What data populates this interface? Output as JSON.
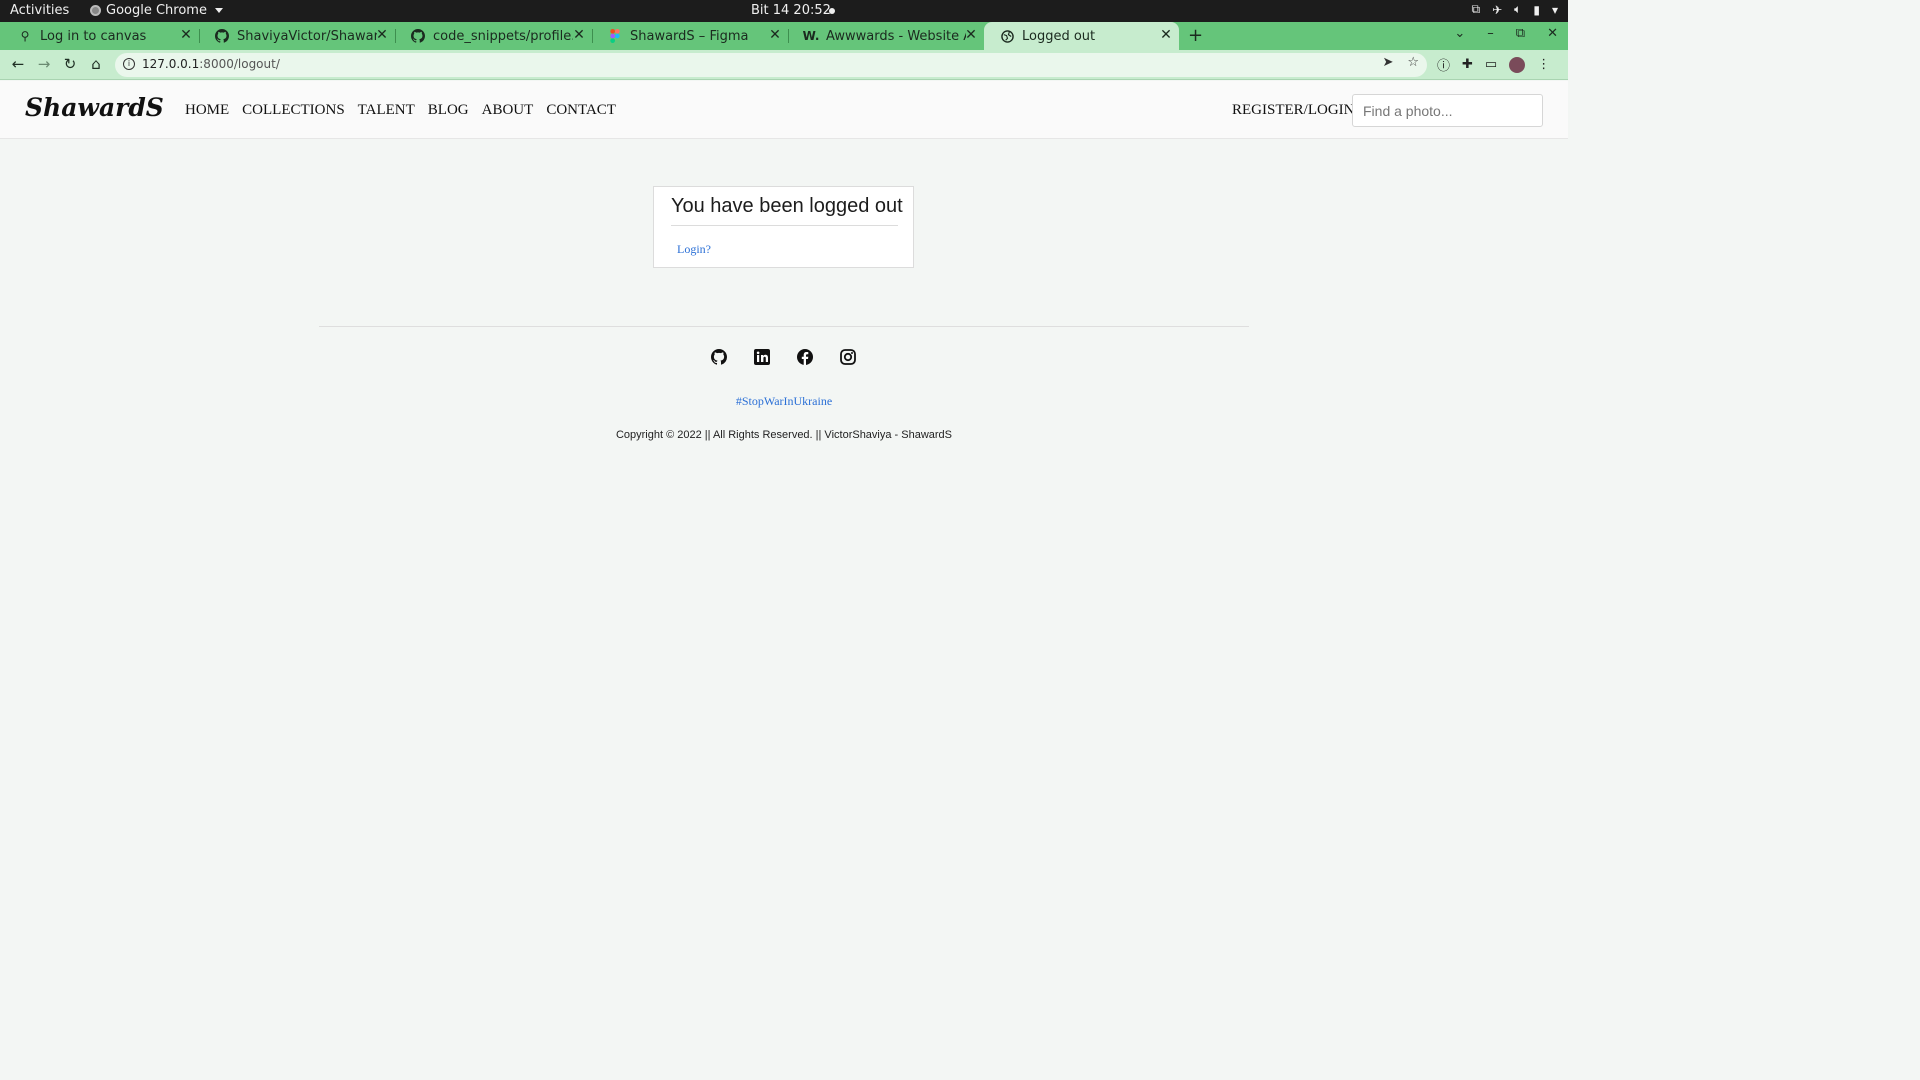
{
  "os_bar": {
    "activities": "Activities",
    "app_name": "Google Chrome",
    "clock": "Bit 14  20:52"
  },
  "browser": {
    "tabs": [
      {
        "title": "Log in to canvas",
        "icon": "canvas-icon"
      },
      {
        "title": "ShaviyaVictor/ShawardS",
        "icon": "github-icon"
      },
      {
        "title": "code_snippets/profile.htm",
        "icon": "github-icon"
      },
      {
        "title": "ShawardS – Figma",
        "icon": "figma-icon"
      },
      {
        "title": "Awwwards - Website Awards",
        "icon": "awwwards-icon"
      },
      {
        "title": "Logged out",
        "icon": "globe-icon"
      }
    ],
    "active_tab": 5,
    "url_host": "127.0.0.1",
    "url_rest": ":8000/logout/",
    "theme_color": "#65c57a"
  },
  "site": {
    "logo": "ShawardS",
    "nav": [
      "HOME",
      "COLLECTIONS",
      "TALENT",
      "BLOG",
      "ABOUT",
      "CONTACT"
    ],
    "register_login": "REGISTER/LOGIN",
    "search_placeholder": "Find a photo..."
  },
  "card": {
    "heading": "You have been logged out",
    "login_link": "Login?"
  },
  "footer": {
    "social": [
      "github-icon",
      "linkedin-icon",
      "facebook-icon",
      "instagram-icon"
    ],
    "hashtag": "#StopWarInUkraine",
    "copyright": "Copyright © 2022 || All Rights Reserved. || VictorShaviya - ShawardS",
    "link_color": "#2a6fd6"
  }
}
